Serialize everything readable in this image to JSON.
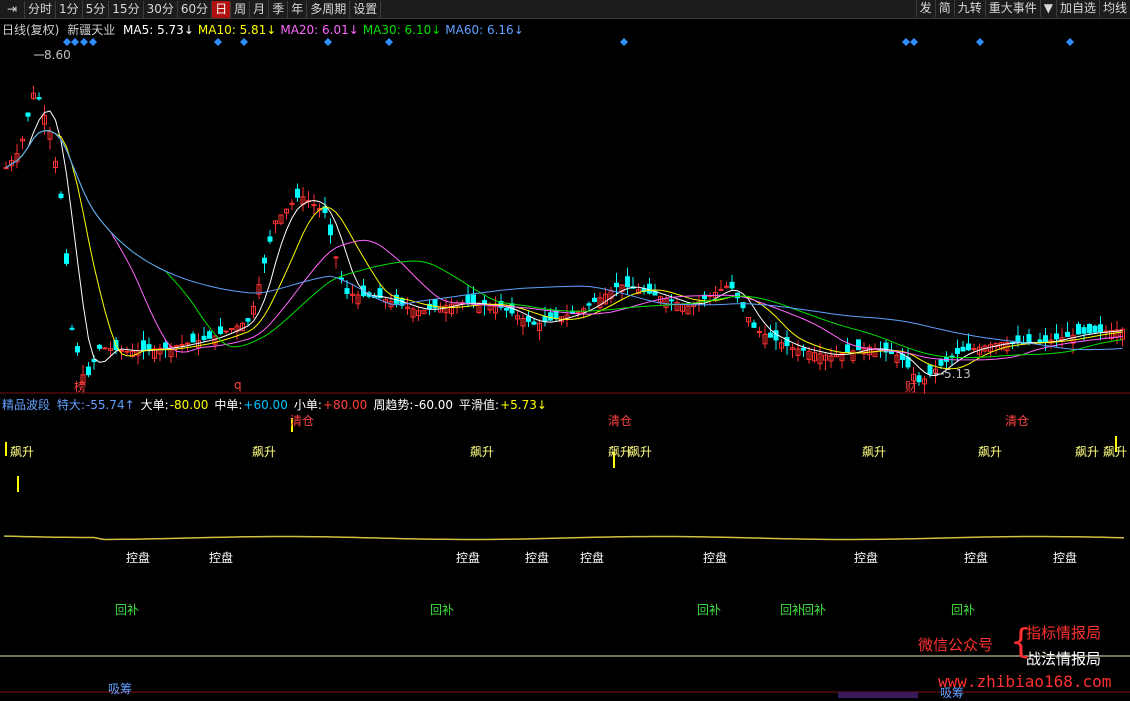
{
  "toolbar": {
    "tabs": [
      {
        "label": "分时"
      },
      {
        "label": "1分"
      },
      {
        "label": "5分"
      },
      {
        "label": "15分"
      },
      {
        "label": "30分"
      },
      {
        "label": "60分"
      },
      {
        "label": "日",
        "active": true
      },
      {
        "label": "周"
      },
      {
        "label": "月"
      },
      {
        "label": "季"
      },
      {
        "label": "年"
      },
      {
        "label": "多周期"
      },
      {
        "label": "设置"
      }
    ],
    "right_buttons": [
      {
        "label": "发"
      },
      {
        "label": "简"
      },
      {
        "label": "九转"
      },
      {
        "label": "重大事件"
      },
      {
        "label": "▼"
      },
      {
        "label": "加自选"
      },
      {
        "label": "均线"
      }
    ]
  },
  "price_header": {
    "period": "日线(复权)",
    "stock": "新疆天业",
    "ma": [
      {
        "label": "MA5: 5.73",
        "arrow": "↓",
        "color": "#ffffff"
      },
      {
        "label": "MA10: 5.81",
        "arrow": "↓",
        "color": "#ffff00"
      },
      {
        "label": "MA20: 6.01",
        "arrow": "↓",
        "color": "#ff66ff"
      },
      {
        "label": "MA30: 6.10",
        "arrow": "↓",
        "color": "#00e000"
      },
      {
        "label": "MA60: 6.16",
        "arrow": "↓",
        "color": "#60a0ff"
      }
    ]
  },
  "price_chart": {
    "high_label": "8.60",
    "low_label": "5.13",
    "event_markers": [
      {
        "text": "榜",
        "color": "#ff4040"
      },
      {
        "text": "q",
        "color": "#ff4040"
      },
      {
        "text": "财",
        "color": "#ff4040"
      }
    ]
  },
  "indicator_header": {
    "name": "精品波段",
    "items": [
      {
        "label": "特大:",
        "value": "-55.74",
        "arrow": "↑",
        "color": "#60a0ff"
      },
      {
        "label": "大单:",
        "value": "-80.00",
        "arrow": "",
        "color": "#ffff00"
      },
      {
        "label": "中单:",
        "value": "+60.00",
        "arrow": "",
        "color": "#00c0ff"
      },
      {
        "label": "小单:",
        "value": "+80.00",
        "arrow": "",
        "color": "#ff4040"
      },
      {
        "label": "周趋势:",
        "value": "-60.00",
        "arrow": "",
        "color": "#ffffff"
      },
      {
        "label": "平滑值:",
        "value": "+5.73",
        "arrow": "↓",
        "color": "#ffff00"
      }
    ]
  },
  "indicator_labels": {
    "qingcang": "清仓",
    "piaosheng": "飙升",
    "kongpan": "控盘",
    "huibu": "回补",
    "xichou": "吸筹"
  },
  "watermark": {
    "left": "微信公众号",
    "right1": "指标情报局",
    "right2": "战法情报局",
    "url": "www.zhibiao168.com"
  },
  "colors": {
    "up": "#ff3030",
    "down": "#00ffff",
    "ma5": "#ffffff",
    "ma10": "#ffff00",
    "ma20": "#ff66ff",
    "ma30": "#00e000",
    "ma60": "#60a0ff",
    "marker": "#3090ff",
    "smooth": "#d0c040"
  }
}
